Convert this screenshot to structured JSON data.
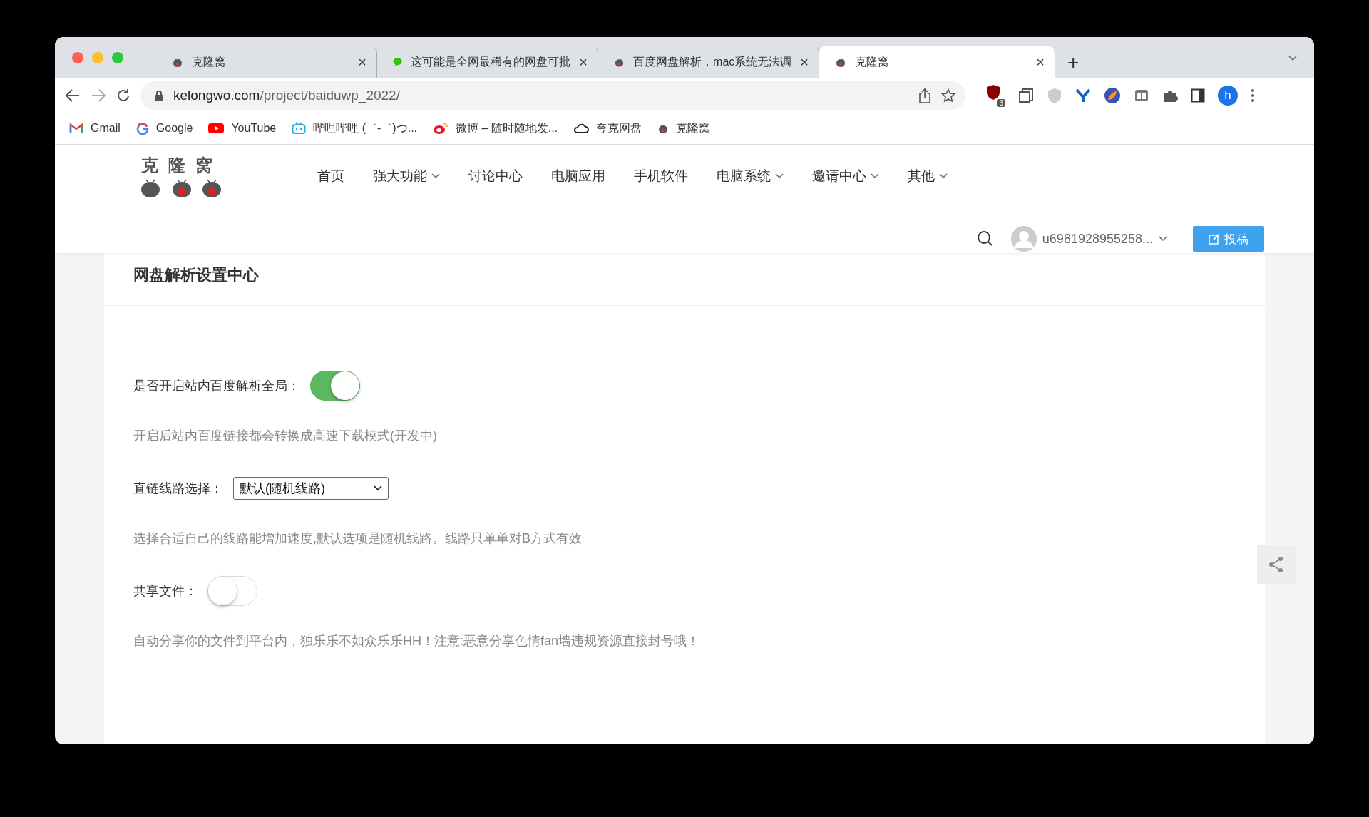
{
  "tabs": [
    {
      "title": "克隆窝",
      "close": "×",
      "selected": false
    },
    {
      "title": "这可能是全网最稀有的网盘可批",
      "close": "×",
      "selected": false
    },
    {
      "title": "百度网盘解析，mac系统无法调",
      "close": "×",
      "selected": false
    },
    {
      "title": "克隆窝",
      "close": "×",
      "selected": true
    }
  ],
  "new_tab": "+",
  "address": {
    "host": "kelongwo.com",
    "path": "/project/baiduwp_2022/"
  },
  "extension_badge": "3",
  "profile_initial": "h",
  "bookmarks": [
    {
      "label": "Gmail"
    },
    {
      "label": "Google"
    },
    {
      "label": "YouTube"
    },
    {
      "label": "哔哩哔哩 (゜-゜)つ..."
    },
    {
      "label": "微博 – 随时随地发..."
    },
    {
      "label": "夸克网盘"
    },
    {
      "label": "克隆窝"
    }
  ],
  "site": {
    "logo": "克隆窝",
    "nav": [
      {
        "label": "首页",
        "dropdown": false
      },
      {
        "label": "强大功能",
        "dropdown": true
      },
      {
        "label": "讨论中心",
        "dropdown": false
      },
      {
        "label": "电脑应用",
        "dropdown": false
      },
      {
        "label": "手机软件",
        "dropdown": false
      },
      {
        "label": "电脑系统",
        "dropdown": true
      },
      {
        "label": "邀请中心",
        "dropdown": true
      },
      {
        "label": "其他",
        "dropdown": true
      }
    ],
    "user": "u6981928955258...",
    "post_button": "投稿"
  },
  "page_title": "网盘解析设置中心",
  "settings": [
    {
      "kind": "toggle",
      "label": "是否开启站内百度解析全局：",
      "on": true,
      "help": "开启后站内百度链接都会转换成高速下载模式(开发中)"
    },
    {
      "kind": "select",
      "label": "直链线路选择：",
      "value": "默认(随机线路)",
      "help": "选择合适自己的线路能增加速度,默认选项是随机线路。线路只单单对B方式有效"
    },
    {
      "kind": "toggle",
      "label": "共享文件：",
      "on": false,
      "help": "自动分享你的文件到平台内，独乐乐不如众乐乐HH！注意:恶意分享色情fan墙违规资源直接封号哦！"
    }
  ]
}
